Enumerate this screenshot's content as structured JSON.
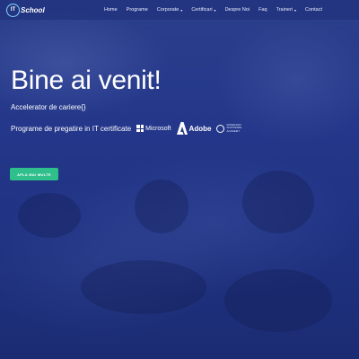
{
  "nav": {
    "logo_text": "School",
    "logo_mark": "IT",
    "items": [
      {
        "label": "Home",
        "has_caret": false
      },
      {
        "label": "Programe",
        "has_caret": false
      },
      {
        "label": "Corporate",
        "has_caret": true
      },
      {
        "label": "Certificari",
        "has_caret": true
      },
      {
        "label": "Despre Noi",
        "has_caret": false
      },
      {
        "label": "Faq",
        "has_caret": false
      },
      {
        "label": "Traineri",
        "has_caret": true
      },
      {
        "label": "Contact",
        "has_caret": false
      }
    ],
    "caret": "▾"
  },
  "hero": {
    "title": "Bine ai venit!",
    "subtitle": "Accelerator de cariere{}",
    "programs_text": "Programe de pregatire in IT certificate",
    "microsoft_label": "Microsoft",
    "adobe_label": "Adobe",
    "partner_label": "ROMANIAN SOFTWARE ACADEMY",
    "cta_label": "AFLA MAI MULTE"
  },
  "colors": {
    "accent": "#2ebf8a",
    "nav_bg": "#2b3f8c",
    "hero_bg": "#24378a",
    "logo_ring": "#7fd7ff"
  }
}
